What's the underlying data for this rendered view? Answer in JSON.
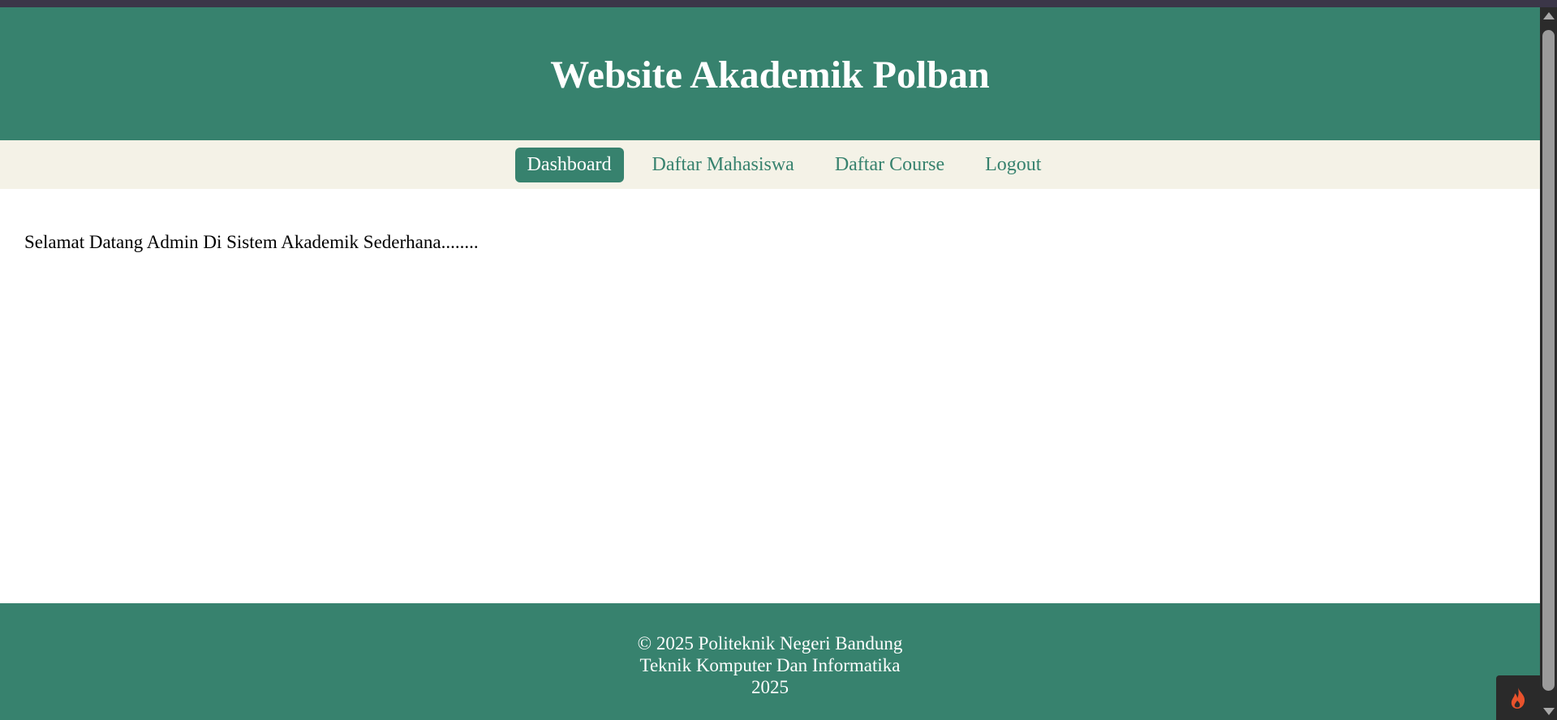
{
  "header": {
    "title": "Website Akademik Polban"
  },
  "nav": {
    "items": [
      {
        "label": "Dashboard",
        "active": true
      },
      {
        "label": "Daftar Mahasiswa",
        "active": false
      },
      {
        "label": "Daftar Course",
        "active": false
      },
      {
        "label": "Logout",
        "active": false
      }
    ]
  },
  "content": {
    "welcome_text": "Selamat Datang Admin Di Sistem Akademik Sederhana........"
  },
  "footer": {
    "line1": "© 2025 Politeknik Negeri Bandung",
    "line2": "Teknik Komputer Dan Informatika",
    "line3": "2025"
  },
  "colors": {
    "primary": "#37826e",
    "nav_background": "#f4f2e7",
    "top_strip": "#3b3648",
    "debug_flame": "#e8522c"
  },
  "icons": {
    "debug_toolbar": "flame-icon"
  }
}
